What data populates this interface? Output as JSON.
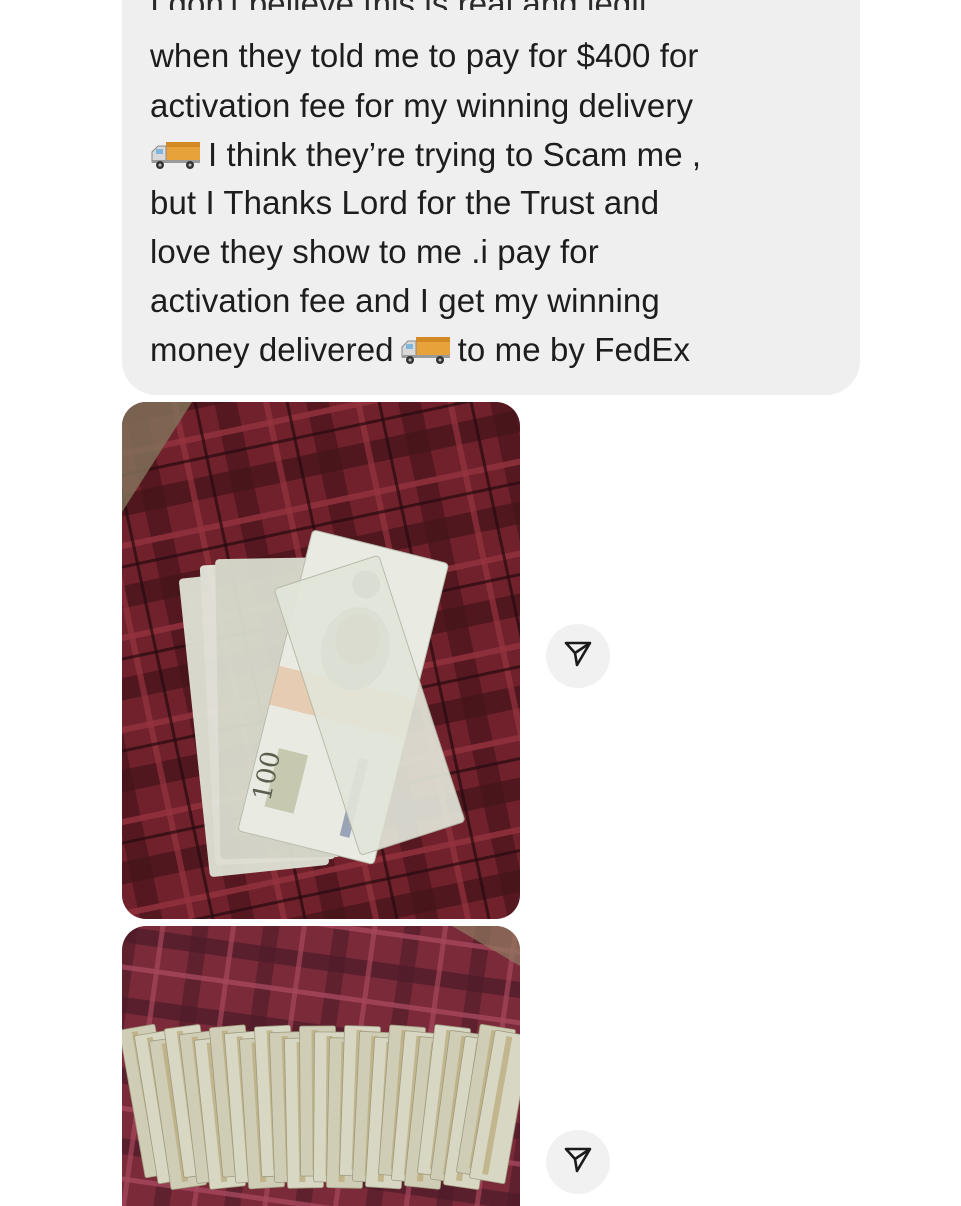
{
  "message": {
    "cut_off_line": "I don't believe this is real and legit",
    "lines": [
      "when they told me to pay for $400 for",
      "activation fee for my winning delivery",
      "I think they’re trying to Scam me ,",
      "but I Thanks Lord for the Trust and",
      "love they show  to me .i pay for",
      "activation fee and I get my winning",
      "money delivered",
      "to me by FedEx"
    ],
    "emoji": "delivery-truck-icon"
  },
  "attachments": [
    {
      "type": "photo",
      "subject": "stack of $100 bills on plaid fabric",
      "bill_text": "100"
    },
    {
      "type": "photo",
      "subject": "fanned $100 bills on plaid fabric",
      "bill_text": ""
    }
  ],
  "actions": {
    "share_icon": "share-icon"
  },
  "colors": {
    "bubble": "#efefef",
    "text": "#1d1d1d",
    "share_button": "#f1f1f1",
    "plaid_red": "#7a2430",
    "plaid_dark": "#3c1319"
  }
}
